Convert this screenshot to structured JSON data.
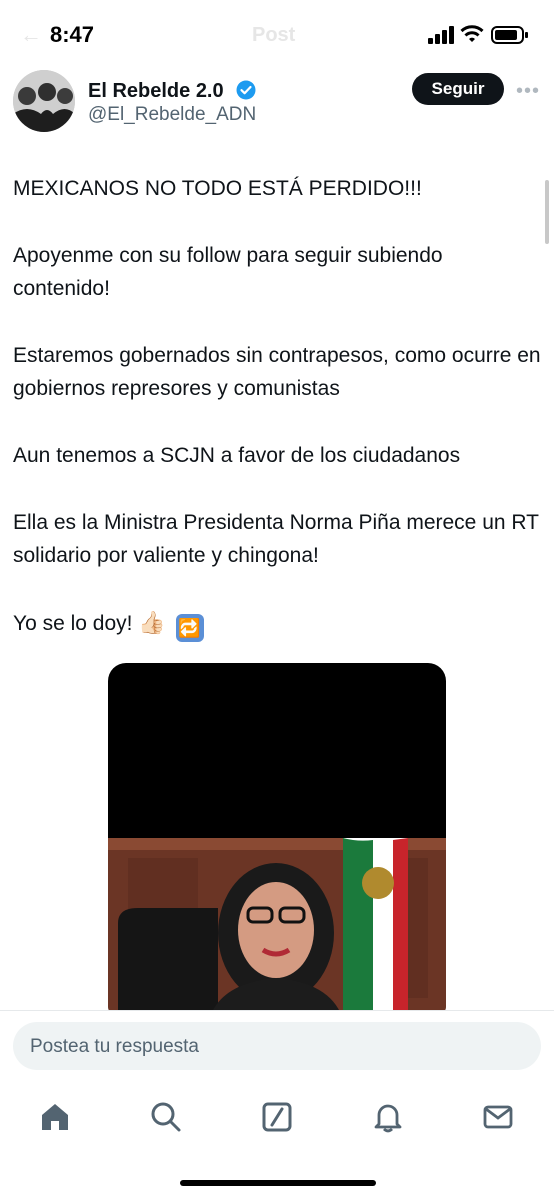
{
  "status_bar": {
    "time": "8:47"
  },
  "header": {
    "ghost_title": "Post"
  },
  "author": {
    "display_name": "El Rebelde 2.0",
    "handle": "@El_Rebelde_ADN",
    "follow_label": "Seguir"
  },
  "tweet": {
    "paragraphs": [
      "MEXICANOS NO TODO ESTÁ PERDIDO!!!",
      "Apoyenme con su follow para seguir subiendo contenido!",
      "Estaremos gobernados sin contrapesos, como ocurre en gobiernos represores y comunistas",
      "Aun tenemos a SCJN a favor de los ciudadanos",
      "Ella es la Ministra Presidenta Norma Piña merece un RT solidario por valiente y chingona!",
      "Yo se lo doy!"
    ],
    "emojis": [
      "👍🏻",
      "🔁"
    ]
  },
  "reply": {
    "placeholder": "Postea tu respuesta"
  },
  "bottom_nav": {
    "items": [
      "home-icon",
      "search-icon",
      "grok-icon",
      "notifications-icon",
      "messages-icon"
    ]
  },
  "colors": {
    "verified": "#1d9bf0",
    "text": "#0f1419",
    "muted": "#536471"
  }
}
